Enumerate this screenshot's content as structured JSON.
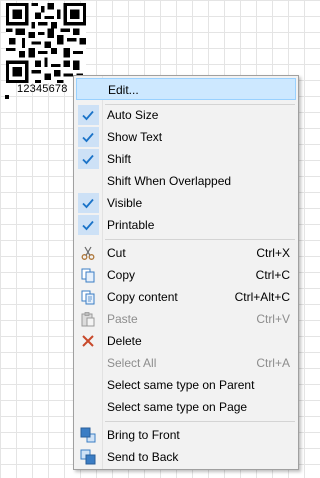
{
  "barcode": {
    "text": "12345678"
  },
  "menu": {
    "edit": "Edit...",
    "auto_size": "Auto Size",
    "show_text": "Show Text",
    "shift": "Shift",
    "shift_overlapped": "Shift When Overlapped",
    "visible": "Visible",
    "printable": "Printable",
    "cut": "Cut",
    "cut_sc": "Ctrl+X",
    "copy": "Copy",
    "copy_sc": "Ctrl+C",
    "copy_content": "Copy content",
    "copy_content_sc": "Ctrl+Alt+C",
    "paste": "Paste",
    "paste_sc": "Ctrl+V",
    "delete": "Delete",
    "select_all": "Select All",
    "select_all_sc": "Ctrl+A",
    "select_parent": "Select same type on Parent",
    "select_page": "Select same type on Page",
    "bring_front": "Bring to Front",
    "send_back": "Send to Back"
  },
  "colors": {
    "check": "#1a73c8",
    "highlight": "#cde8ff",
    "menu_bg": "#f2f2f2"
  }
}
